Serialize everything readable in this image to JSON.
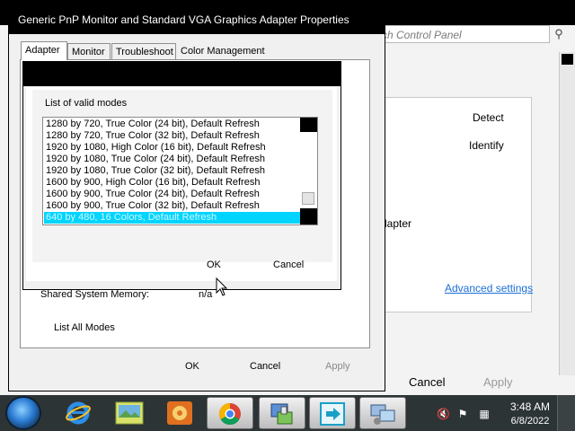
{
  "background_window": {
    "search_placeholder": "rch Control Panel",
    "detect_label": "Detect",
    "identify_label": "Identify",
    "adapter_text": "dapter",
    "advanced_settings_link": "Advanced settings",
    "cancel_label": "Cancel",
    "apply_label": "Apply"
  },
  "properties_dialog": {
    "title": "Generic PnP Monitor and Standard VGA Graphics Adapter Properties",
    "tabs": [
      {
        "label": "Adapter",
        "active": true
      },
      {
        "label": "Monitor",
        "active": false
      },
      {
        "label": "Troubleshoot",
        "active": false
      },
      {
        "label": "Color Management",
        "active": false
      }
    ],
    "shared_memory_label": "Shared System Memory:",
    "shared_memory_value": "n/a",
    "list_all_modes_label": "List All Modes",
    "ok_label": "OK",
    "cancel_label": "Cancel",
    "apply_label": "Apply"
  },
  "modes_dialog": {
    "list_label": "List of valid modes",
    "modes": [
      "1280 by 720, True Color (24 bit), Default Refresh",
      "1280 by 720, True Color (32 bit), Default Refresh",
      "1920 by 1080, High Color (16 bit), Default Refresh",
      "1920 by 1080, True Color (24 bit), Default Refresh",
      "1920 by 1080, True Color (32 bit), Default Refresh",
      "1600 by 900, High Color (16 bit), Default Refresh",
      "1600 by 900, True Color (24 bit), Default Refresh",
      "1600 by 900, True Color (32 bit), Default Refresh",
      "640 by 480, 16 Colors, Default Refresh"
    ],
    "selected_index": 8,
    "ok_label": "OK",
    "cancel_label": "Cancel"
  },
  "taskbar": {
    "apps": [
      {
        "name": "internet-explorer",
        "icon": "ie-icon"
      },
      {
        "name": "image-viewer",
        "icon": "picture-icon"
      },
      {
        "name": "media-player",
        "icon": "media-icon"
      },
      {
        "name": "chrome",
        "icon": "chrome-icon"
      },
      {
        "name": "control-panel",
        "icon": "control-panel-icon"
      },
      {
        "name": "remote-app",
        "icon": "arrow-window-icon"
      },
      {
        "name": "display-settings",
        "icon": "display-icon"
      }
    ],
    "time": "3:48 AM",
    "date": "6/8/2022"
  },
  "colors": {
    "selection": "#00d4ff",
    "link": "#1a6fd6",
    "taskbar": "#2d3436"
  }
}
